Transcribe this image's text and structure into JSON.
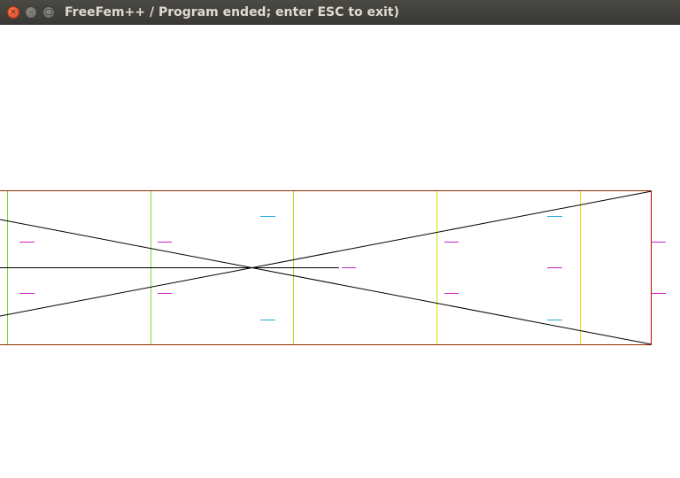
{
  "window": {
    "title": "FreeFem++ / Program ended; enter ESC to exit)",
    "buttons": {
      "close_glyph": "×",
      "minimize_glyph": "–",
      "maximize_glyph": "□"
    }
  },
  "colors": {
    "boundary": "#c00000",
    "mesh_edge": "#000000",
    "isoline_green": "#66dd33",
    "isoline_yellow": "#e8e800",
    "arrow_magenta": "#cc22cc",
    "arrow_cyan": "#22aadd"
  }
}
